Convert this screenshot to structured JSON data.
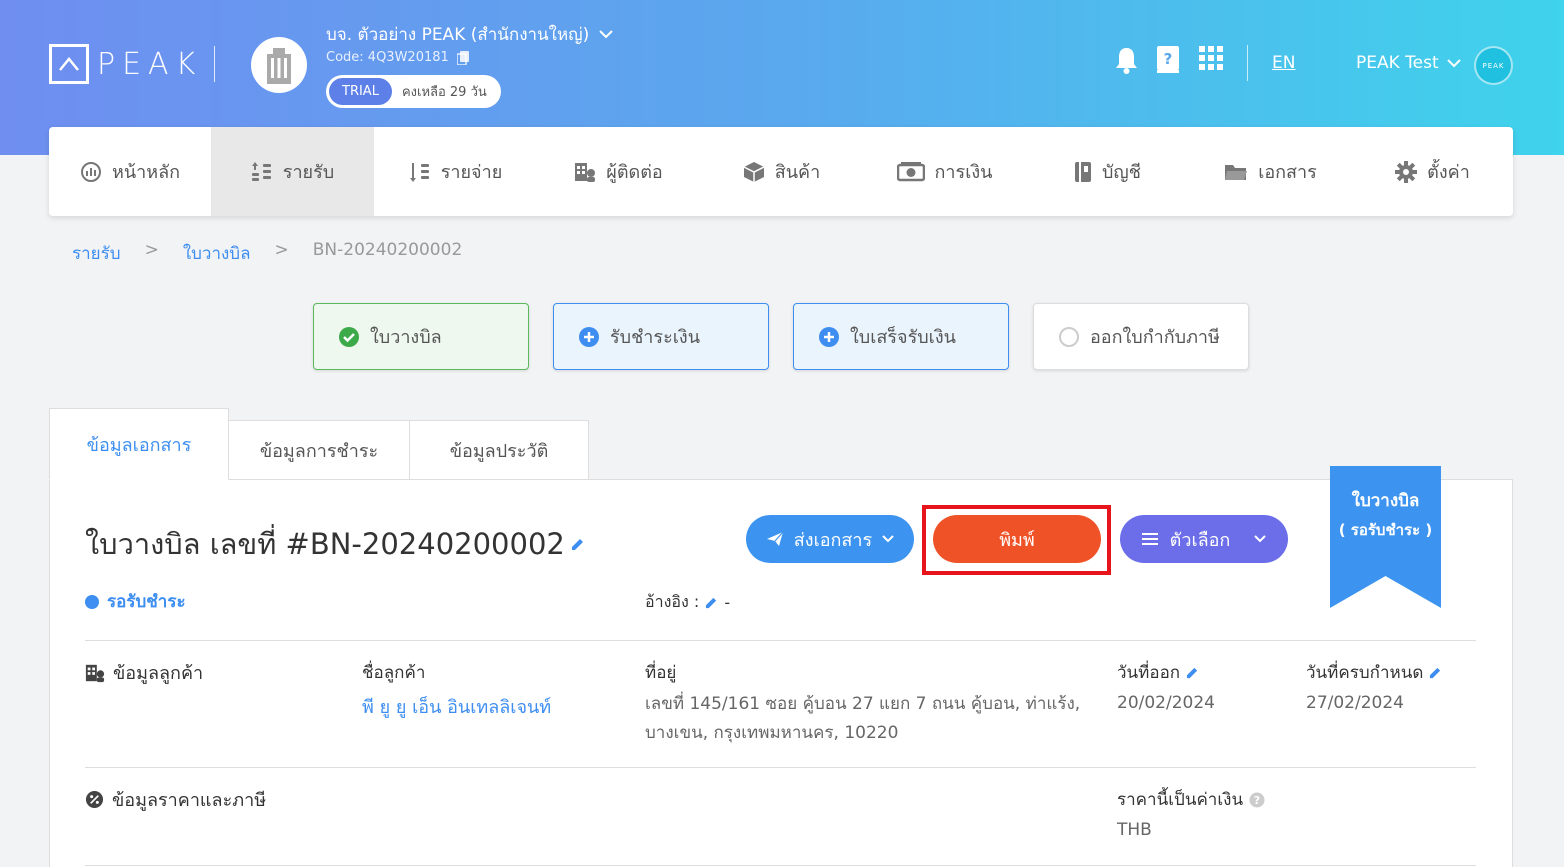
{
  "header": {
    "logo_text": "PEAK",
    "company_name": "บจ. ตัวอย่าง PEAK (สำนักงานใหญ่)",
    "company_code": "Code: 4Q3W20181",
    "trial_badge": "TRIAL",
    "trial_days": "คงเหลือ 29 วัน",
    "lang": "EN",
    "user_name": "PEAK Test",
    "avatar_text": "PEAK"
  },
  "nav": {
    "items": [
      {
        "label": "หน้าหลัก",
        "icon": "dashboard-icon"
      },
      {
        "label": "รายรับ",
        "icon": "income-icon"
      },
      {
        "label": "รายจ่าย",
        "icon": "expense-icon"
      },
      {
        "label": "ผู้ติดต่อ",
        "icon": "contacts-icon"
      },
      {
        "label": "สินค้า",
        "icon": "product-icon"
      },
      {
        "label": "การเงิน",
        "icon": "money-icon"
      },
      {
        "label": "บัญชี",
        "icon": "accounting-icon"
      },
      {
        "label": "เอกสาร",
        "icon": "folder-icon"
      },
      {
        "label": "ตั้งค่า",
        "icon": "gear-icon"
      }
    ],
    "active": 1
  },
  "breadcrumb": {
    "level1": "รายรับ",
    "level2": "ใบวางบิล",
    "current": "BN-20240200002",
    "separator": ">"
  },
  "flow": {
    "step1": "ใบวางบิล",
    "step2": "รับชำระเงิน",
    "step3": "ใบเสร็จรับเงิน",
    "step4": "ออกใบกำกับภาษี"
  },
  "tabs": {
    "doc_info": "ข้อมูลเอกสาร",
    "payment_info": "ข้อมูลการชำระ",
    "history": "ข้อมูลประวัติ"
  },
  "document": {
    "title": "ใบวางบิล เลขที่ #BN-20240200002",
    "status": "รอรับชำระ",
    "ref_label": "อ้างอิง :",
    "ref_value": "-",
    "ribbon_line1": "ใบวางบิล",
    "ribbon_line2": "( รอรับชำระ )"
  },
  "actions": {
    "send": "ส่งเอกสาร",
    "print": "พิมพ์",
    "options": "ตัวเลือก"
  },
  "customer": {
    "section": "ข้อมูลลูกค้า",
    "name_label": "ชื่อลูกค้า",
    "name": "พี ยู ยู เอ็น อินเทลลิเจนท์",
    "address_label": "ที่อยู่",
    "address": "เลขที่ 145/161 ซอย คู้บอน 27 แยก 7 ถนน คู้บอน, ท่าแร้ง, บางเขน, กรุงเทพมหานคร, 10220",
    "issue_label": "วันที่ออก",
    "issue_date": "20/02/2024",
    "due_label": "วันที่ครบกำหนด",
    "due_date": "27/02/2024"
  },
  "pricing": {
    "section": "ข้อมูลราคาและภาษี",
    "currency_label": "ราคานี้เป็นค่าเงิน",
    "currency": "THB"
  },
  "colors": {
    "accent_blue": "#3d8ef0",
    "print_orange": "#f05228",
    "options_purple": "#6b6ee8",
    "highlight_red": "#e8141c"
  }
}
